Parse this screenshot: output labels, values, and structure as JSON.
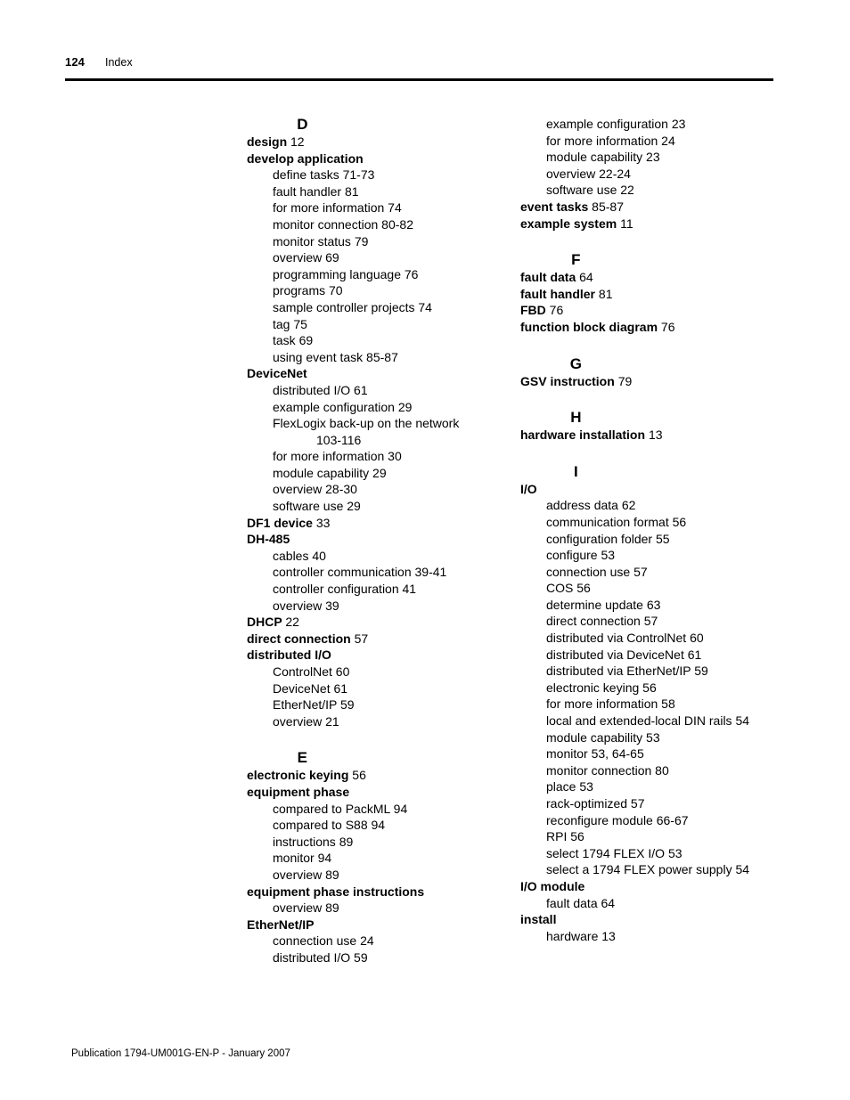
{
  "header": {
    "page_number": "124",
    "label": "Index"
  },
  "footer": {
    "publication": "Publication 1794-UM001G-EN-P - January 2007"
  },
  "columns": {
    "left": {
      "sections": [
        {
          "letter": "D",
          "entries": [
            {
              "term": "design",
              "pages": "12"
            },
            {
              "term": "develop application",
              "pages": ""
            },
            {
              "sub": "define tasks 71-73"
            },
            {
              "sub": "fault handler 81"
            },
            {
              "sub": "for more information 74"
            },
            {
              "sub": "monitor connection 80-82"
            },
            {
              "sub": "monitor status 79"
            },
            {
              "sub": "overview 69"
            },
            {
              "sub": "programming language 76"
            },
            {
              "sub": "programs 70"
            },
            {
              "sub": "sample controller projects 74"
            },
            {
              "sub": "tag 75"
            },
            {
              "sub": "task 69"
            },
            {
              "sub": "using event task 85-87"
            },
            {
              "term": "DeviceNet",
              "pages": ""
            },
            {
              "sub": "distributed I/O 61"
            },
            {
              "sub": "example configuration 29"
            },
            {
              "sub": "FlexLogix back-up on the network",
              "cont": "103-116"
            },
            {
              "sub": "for more information 30"
            },
            {
              "sub": "module capability 29"
            },
            {
              "sub": "overview 28-30"
            },
            {
              "sub": "software use 29"
            },
            {
              "term": "DF1 device",
              "pages": "33"
            },
            {
              "term": "DH-485",
              "pages": ""
            },
            {
              "sub": "cables 40"
            },
            {
              "sub": "controller communication 39-41"
            },
            {
              "sub": "controller configuration 41"
            },
            {
              "sub": "overview 39"
            },
            {
              "term": "DHCP",
              "pages": "22"
            },
            {
              "term": "direct connection",
              "pages": "57"
            },
            {
              "term": "distributed I/O",
              "pages": ""
            },
            {
              "sub": "ControlNet 60"
            },
            {
              "sub": "DeviceNet 61"
            },
            {
              "sub": "EtherNet/IP 59"
            },
            {
              "sub": "overview 21"
            }
          ]
        },
        {
          "letter": "E",
          "entries": [
            {
              "term": "electronic keying",
              "pages": "56"
            },
            {
              "term": "equipment phase",
              "pages": ""
            },
            {
              "sub": "compared to PackML 94"
            },
            {
              "sub": "compared to S88 94"
            },
            {
              "sub": "instructions 89"
            },
            {
              "sub": "monitor 94"
            },
            {
              "sub": "overview 89"
            },
            {
              "term": "equipment phase instructions",
              "pages": ""
            },
            {
              "sub": "overview 89"
            },
            {
              "term": "EtherNet/IP",
              "pages": ""
            },
            {
              "sub": "connection use 24"
            },
            {
              "sub": "distributed I/O 59"
            }
          ]
        }
      ]
    },
    "right": {
      "sections": [
        {
          "letter": "",
          "entries": [
            {
              "sub": "example configuration 23"
            },
            {
              "sub": "for more information 24"
            },
            {
              "sub": "module capability 23"
            },
            {
              "sub": "overview 22-24"
            },
            {
              "sub": "software use 22"
            },
            {
              "term": "event tasks",
              "pages": "85-87"
            },
            {
              "term": "example system",
              "pages": "11"
            }
          ]
        },
        {
          "letter": "F",
          "entries": [
            {
              "term": "fault data",
              "pages": "64"
            },
            {
              "term": "fault handler",
              "pages": "81"
            },
            {
              "term": "FBD",
              "pages": "76"
            },
            {
              "term": "function block diagram",
              "pages": "76"
            }
          ]
        },
        {
          "letter": "G",
          "entries": [
            {
              "term": "GSV instruction",
              "pages": "79"
            }
          ]
        },
        {
          "letter": "H",
          "entries": [
            {
              "term": "hardware installation",
              "pages": "13"
            }
          ]
        },
        {
          "letter": "I",
          "entries": [
            {
              "term": "I/O",
              "pages": ""
            },
            {
              "sub": "address data 62"
            },
            {
              "sub": "communication format 56"
            },
            {
              "sub": "configuration folder 55"
            },
            {
              "sub": "configure 53"
            },
            {
              "sub": "connection use 57"
            },
            {
              "sub": "COS 56"
            },
            {
              "sub": "determine update 63"
            },
            {
              "sub": "direct connection 57"
            },
            {
              "sub": "distributed via ControlNet 60"
            },
            {
              "sub": "distributed via DeviceNet 61"
            },
            {
              "sub": "distributed via EtherNet/IP 59"
            },
            {
              "sub": "electronic keying 56"
            },
            {
              "sub": "for more information 58"
            },
            {
              "sub": "local and extended-local DIN rails 54"
            },
            {
              "sub": "module capability 53"
            },
            {
              "sub": "monitor 53, 64-65"
            },
            {
              "sub": "monitor connection 80"
            },
            {
              "sub": "place 53"
            },
            {
              "sub": "rack-optimized 57"
            },
            {
              "sub": "reconfigure module 66-67"
            },
            {
              "sub": "RPI 56"
            },
            {
              "sub": "select 1794 FLEX I/O 53"
            },
            {
              "sub": "select a 1794 FLEX power supply 54"
            },
            {
              "term": "I/O module",
              "pages": ""
            },
            {
              "sub": "fault data 64"
            },
            {
              "term": "install",
              "pages": ""
            },
            {
              "sub": "hardware 13"
            }
          ]
        }
      ]
    }
  }
}
